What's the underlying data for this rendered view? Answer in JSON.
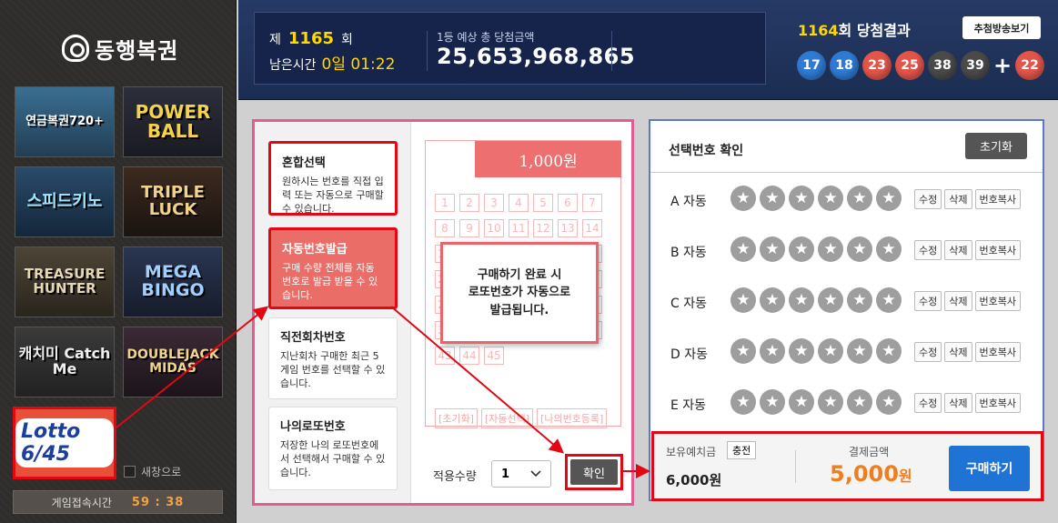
{
  "brand": {
    "name": "동행복권"
  },
  "games": [
    {
      "label": "연금복권720+",
      "icon": "pension-lottery-icon"
    },
    {
      "label": "POWER BALL",
      "icon": "powerball-icon"
    },
    {
      "label": "스피드키노",
      "icon": "speedkeno-icon"
    },
    {
      "label": "TRIPLE LUCK",
      "icon": "triple-luck-icon"
    },
    {
      "label": "TREASURE HUNTER",
      "icon": "treasure-hunter-icon"
    },
    {
      "label": "MEGA BINGO",
      "icon": "mega-bingo-icon"
    },
    {
      "label": "캐치미 Catch Me",
      "icon": "catch-me-icon"
    },
    {
      "label": "DOUBLEJACK MIDAS",
      "icon": "doublejack-icon"
    }
  ],
  "lotto": {
    "label": "Lotto 6/45"
  },
  "new_window": {
    "label": "새창으로"
  },
  "game_timer": {
    "label": "게임접속시간",
    "value": "59 : 38"
  },
  "header": {
    "draw_prefix": "제",
    "draw_number": "1165",
    "draw_suffix": "회",
    "remain_label": "남은시간",
    "remain_value": "0일 01:22",
    "prize_label": "1등 예상 총 당첨금액",
    "prize_value": "25,653,968,865",
    "result_number": "1164",
    "result_suffix": "회 당첨결과",
    "broadcast_button": "추첨방송보기",
    "winning_numbers": [
      "17",
      "18",
      "23",
      "25",
      "38",
      "39"
    ],
    "bonus_number": "22",
    "ball_colors": [
      "#2f7ad3",
      "#2f7ad3",
      "#e2554b",
      "#e2554b",
      "#4a4a4a",
      "#4a4a4a",
      "#e2554b"
    ]
  },
  "tabs": [
    {
      "title": "혼합선택",
      "desc": "원하시는 번호를 직접 입력 또는 자동으로 구매할 수 있습니다."
    },
    {
      "title": "자동번호발급",
      "desc": "구매 수량 전체를 자동 번호로 발급 받을 수 있습니다."
    },
    {
      "title": "직전회차번호",
      "desc": "지난회차 구매한 최근 5게임 번호를 선택할 수 있습니다."
    },
    {
      "title": "나의로또번호",
      "desc": "저장한 나의 로또번호에서 선택해서 구매할 수 있습니다."
    }
  ],
  "ticket": {
    "price": "1,000원",
    "numbers": [
      "1",
      "2",
      "3",
      "4",
      "5",
      "6",
      "7",
      "8",
      "9",
      "10",
      "11",
      "12",
      "13",
      "14",
      "15",
      "16",
      "17",
      "18",
      "19",
      "20",
      "21",
      "22",
      "23",
      "24",
      "25",
      "26",
      "27",
      "28",
      "29",
      "30",
      "31",
      "32",
      "33",
      "34",
      "35",
      "36",
      "37",
      "38",
      "39",
      "40",
      "41",
      "42",
      "43",
      "44",
      "45"
    ],
    "buttons": [
      "[초기화]",
      "[자동선택]",
      "[나의번호등록]"
    ]
  },
  "popup": {
    "text": "구매하기 완료 시\n로또번호가 자동으로\n발급됩니다."
  },
  "quantity": {
    "label": "적용수량",
    "value": "1"
  },
  "confirm_button": "확인",
  "selection": {
    "title": "선택번호 확인",
    "reset_button": "초기화",
    "rows": [
      {
        "label": "A 자동"
      },
      {
        "label": "B 자동"
      },
      {
        "label": "C 자동"
      },
      {
        "label": "D 자동"
      },
      {
        "label": "E 자동"
      }
    ],
    "star": "★",
    "actions": [
      "수정",
      "삭제",
      "번호복사"
    ]
  },
  "payment": {
    "balance_label": "보유예치금",
    "charge_button": "충전",
    "balance_value": "6,000원",
    "pay_label": "결제금액",
    "pay_amount": "5,000",
    "pay_unit": "원",
    "buy_button": "구매하기"
  }
}
